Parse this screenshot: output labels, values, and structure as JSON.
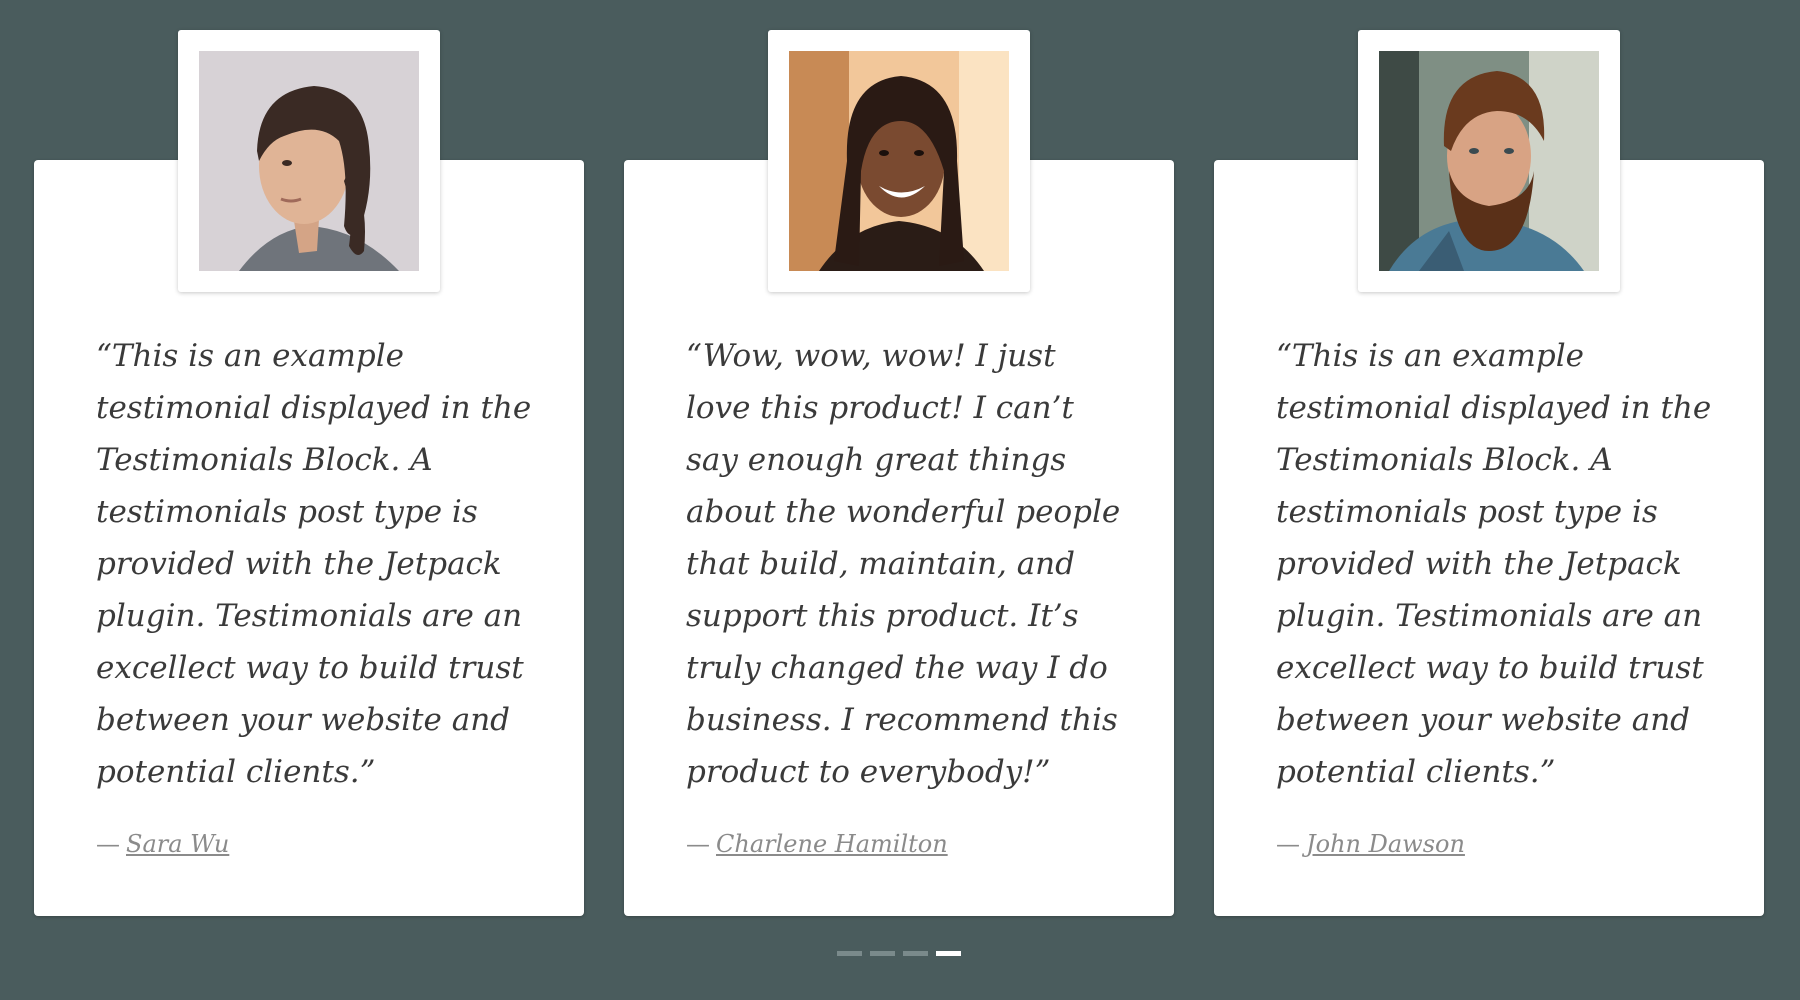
{
  "colors": {
    "background": "#4a5c5d",
    "card": "#ffffff",
    "quote_text": "#3a3a3a",
    "author_text": "#8b8b8b",
    "dot_inactive": "#7a8a8b",
    "dot_active": "#ffffff"
  },
  "testimonials": [
    {
      "quote": "“This is an example testimonial displayed in the Testimonials Block. A testimonials post type is provided with the Jetpack plugin. Testimonials are an excellect way to build trust between your website and potential clients.”",
      "dash": "—",
      "author": "Sara Wu"
    },
    {
      "quote": "“Wow, wow, wow! I just love this product! I can’t say enough great things about the wonderful people that build, maintain, and support this product. It’s truly changed the way I do business. I recommend this product to everybody!”",
      "dash": "—",
      "author": "Charlene Hamilton"
    },
    {
      "quote": "“This is an example testimonial displayed in the Testimonials Block. A testimonials post type is provided with the Jetpack plugin. Testimonials are an excellect way to build trust between your website and potential clients.”",
      "dash": "—",
      "author": "John Dawson"
    }
  ],
  "pagination": {
    "count": 4,
    "active_index": 3
  }
}
